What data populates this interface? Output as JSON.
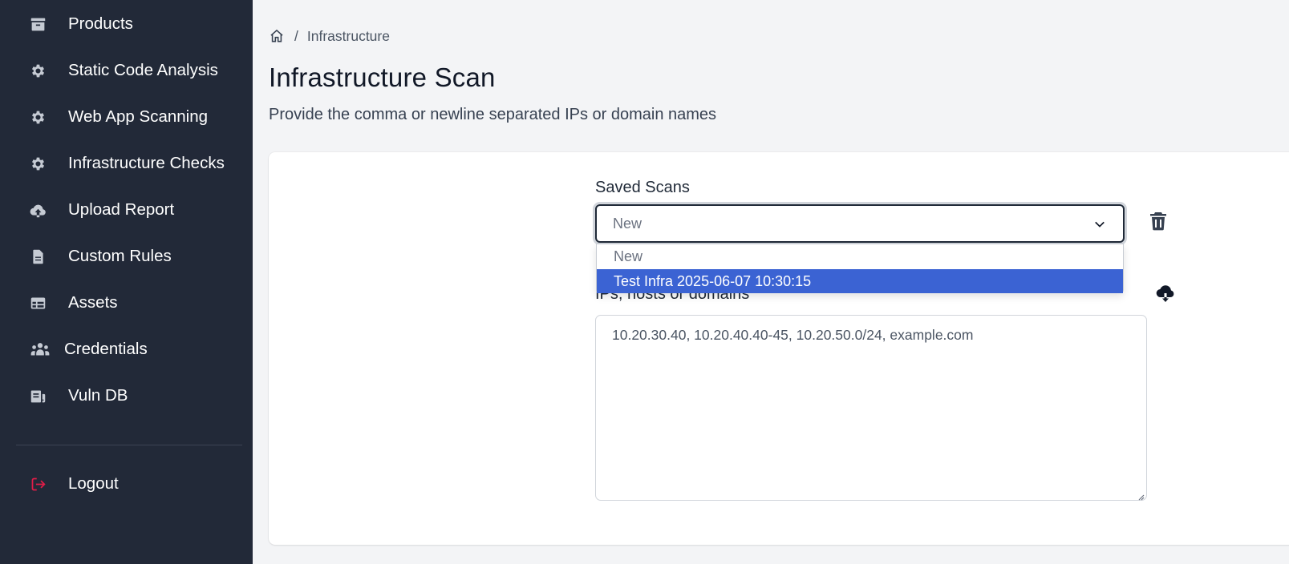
{
  "sidebar": {
    "items": [
      {
        "label": "Products",
        "icon": "archive-icon"
      },
      {
        "label": "Static Code Analysis",
        "icon": "gear-icon"
      },
      {
        "label": "Web App Scanning",
        "icon": "gear-icon"
      },
      {
        "label": "Infrastructure Checks",
        "icon": "gear-icon"
      },
      {
        "label": "Upload Report",
        "icon": "cloud-upload-icon"
      },
      {
        "label": "Custom Rules",
        "icon": "document-icon"
      },
      {
        "label": "Assets",
        "icon": "table-icon"
      },
      {
        "label": "Credentials",
        "icon": "users-icon"
      },
      {
        "label": "Vuln DB",
        "icon": "database-icon"
      }
    ],
    "logout": {
      "label": "Logout",
      "icon": "logout-icon"
    }
  },
  "breadcrumb": {
    "home_icon": "home-icon",
    "separator": "/",
    "current": "Infrastructure"
  },
  "page": {
    "title": "Infrastructure Scan",
    "description": "Provide the comma or newline separated IPs or domain names"
  },
  "saved_scans": {
    "label": "Saved Scans",
    "selected": "New",
    "options": [
      "New",
      "Test Infra 2025-06-07 10:30:15"
    ],
    "highlighted": "Test Infra 2025-06-07 10:30:15"
  },
  "hosts": {
    "label": "IPs, hosts or domains",
    "value": "10.20.30.40, 10.20.40.40-45, 10.20.50.0/24, example.com"
  },
  "colors": {
    "sidebar_bg": "#222938",
    "page_bg": "#f3f4f6",
    "highlight": "#3b63d3",
    "logout_accent": "#e11d48"
  }
}
